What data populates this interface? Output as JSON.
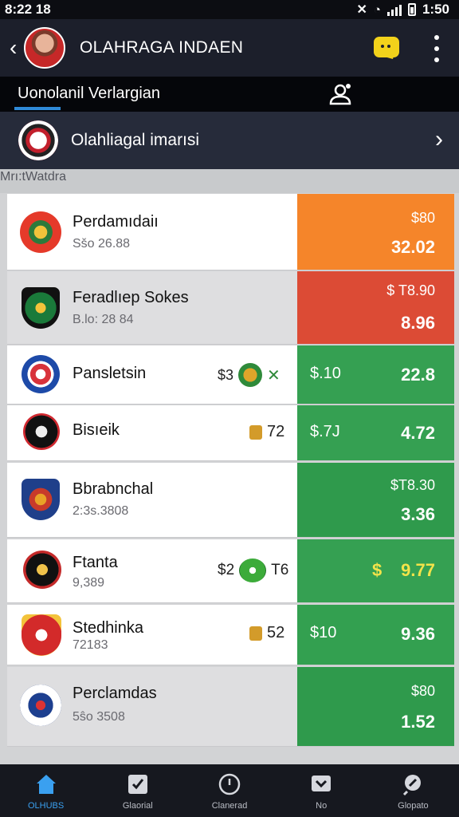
{
  "status": {
    "time": "8:22 18",
    "clock": "1:50"
  },
  "header": {
    "title": "OLAHRAGA INDAEN"
  },
  "tab": {
    "label": "Uonolanil Verlargian"
  },
  "league": {
    "title": "Olahliagal imarısi"
  },
  "section": {
    "label": "Mrı:tWatdra"
  },
  "teams": [
    {
      "name": "Perdamıdaiı",
      "sub": "Sšo 26.88",
      "price_top": "$80",
      "price_bottom": "32.02",
      "color": "#f5852a"
    },
    {
      "name": "Feradlıep Sokes",
      "sub": "B.lo: 28 84",
      "price_top": "$ T8.90",
      "price_bottom": "8.96",
      "color": "#dc4b35"
    },
    {
      "name": "Pansletsin",
      "badge": "$3",
      "price_left": "$.10",
      "price_bottom": "22.8",
      "color": "#35a052"
    },
    {
      "name": "Bisıeik",
      "badge": "72",
      "price_left": "$.7J",
      "price_bottom": "4.72",
      "color": "#35a052"
    },
    {
      "name": "Bbrabnchal",
      "sub": "2:3s.3808",
      "price_top": "$T8.30",
      "price_bottom": "3.36",
      "color": "#2f9a4c"
    },
    {
      "name": "Ftanta",
      "sub": "9,389",
      "badge": "$2",
      "badge_value": "T6",
      "price_left": "$",
      "price_bottom": "9.77",
      "color": "#35a052"
    },
    {
      "name": "Stedhinka",
      "sub": "72183",
      "badge": "52",
      "price_left": "$10",
      "price_bottom": "9.36",
      "color": "#33a050"
    },
    {
      "name": "Perclamdas",
      "sub": "5ŝo 3508",
      "price_top": "$80",
      "price_bottom": "1.52",
      "color": "#2f9a4c"
    }
  ],
  "nav": [
    {
      "label": "OLHUBS",
      "icon": "home-icon"
    },
    {
      "label": "Glaorial",
      "icon": "clipboard-icon"
    },
    {
      "label": "Clanerad",
      "icon": "clock-icon"
    },
    {
      "label": "No",
      "icon": "chevron-box-icon"
    },
    {
      "label": "Glopato",
      "icon": "search-icon"
    }
  ]
}
